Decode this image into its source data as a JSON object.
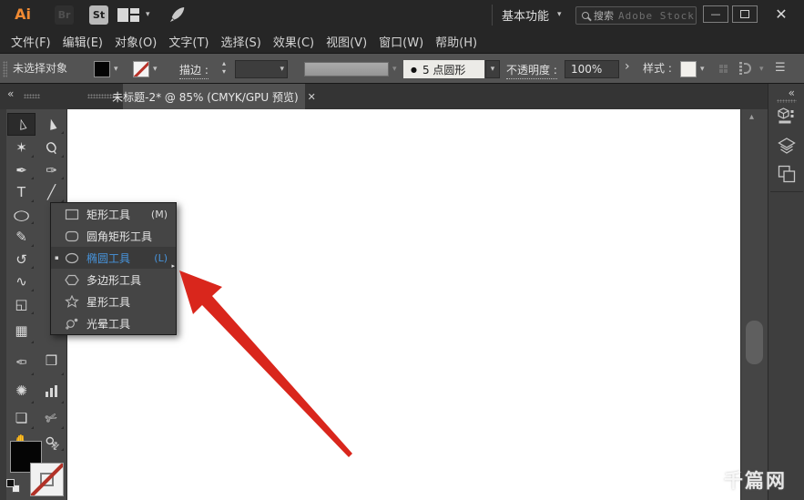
{
  "titlebar": {
    "app_logo": "Ai",
    "bridge_label": "Br",
    "stock_label": "St",
    "workspace_switcher": "基本功能",
    "search_text": "搜索",
    "search_placeholder": "Adobe Stock"
  },
  "menubar": {
    "items": [
      "文件(F)",
      "编辑(E)",
      "对象(O)",
      "文字(T)",
      "选择(S)",
      "效果(C)",
      "视图(V)",
      "窗口(W)",
      "帮助(H)"
    ]
  },
  "controlbar": {
    "no_selection": "未选择对象",
    "stroke_label": "描边 :",
    "brush_dot": "●",
    "brush_value": "5 点圆形",
    "opacity_label": "不透明度 :",
    "opacity_value": "100%",
    "style_label": "样式 :"
  },
  "tabbar": {
    "document_title": "未标题-2* @ 85% (CMYK/GPU 预览)"
  },
  "toolbar": {
    "columns": [
      [
        {
          "name": "selection-tool",
          "glyph": "▻",
          "rotate": -105,
          "active": true
        },
        {
          "name": "magic-wand-tool",
          "glyph": "✶"
        },
        {
          "name": "pen-tool",
          "glyph": "✒"
        },
        {
          "name": "type-tool",
          "glyph": "T"
        },
        {
          "name": "ellipse-tool",
          "glyph": "○",
          "wide": true
        },
        {
          "name": "shaper-tool",
          "glyph": "✎"
        },
        {
          "name": "rotate-tool",
          "glyph": "↺"
        },
        {
          "name": "width-tool",
          "glyph": "∿"
        },
        {
          "name": "free-transform-tool",
          "glyph": "◱"
        },
        {
          "name": "mesh-tool",
          "glyph": "▦"
        },
        {
          "name": "eyedropper-tool",
          "glyph": "✑",
          "rotate": 180
        },
        {
          "name": "symbol-sprayer-tool",
          "glyph": "✺"
        },
        {
          "name": "artboard-tool",
          "glyph": "❏"
        },
        {
          "name": "hand-tool",
          "glyph": "✋"
        }
      ],
      [
        {
          "name": "direct-selection-tool",
          "glyph": "►",
          "rotate": -105
        },
        {
          "name": "lasso-tool",
          "glyph": "Ϙ",
          "rotate": -35
        },
        {
          "name": "curvature-tool",
          "glyph": "✑"
        },
        {
          "name": "line-segment-tool",
          "glyph": "╱"
        },
        {
          "name": "hidden-tool-slot",
          "empty": true
        },
        {
          "name": "hidden-tool-slot",
          "empty": true
        },
        {
          "name": "hidden-tool-slot",
          "empty": true
        },
        {
          "name": "hidden-tool-slot",
          "empty": true
        },
        {
          "name": "hidden-tool-slot",
          "empty": true
        },
        {
          "name": "hidden-tool-slot",
          "empty": true
        },
        {
          "name": "shape-builder-tool",
          "glyph": "❒"
        },
        {
          "name": "graph-tool",
          "bars": true
        },
        {
          "name": "knife-tool",
          "glyph": "✄",
          "rotate": -20
        },
        {
          "name": "zoom-tool",
          "glyph": "⚲",
          "rotate": -45
        }
      ]
    ]
  },
  "flyout": {
    "items": [
      {
        "label": "矩形工具",
        "shortcut": "(M)"
      },
      {
        "label": "圆角矩形工具",
        "shortcut": ""
      },
      {
        "label": "椭圆工具",
        "shortcut": "(L)"
      },
      {
        "label": "多边形工具",
        "shortcut": ""
      },
      {
        "label": "星形工具",
        "shortcut": ""
      },
      {
        "label": "光晕工具",
        "shortcut": ""
      }
    ]
  },
  "icons": {
    "chevron_down": "▾",
    "collapse": "«",
    "menu": "☰",
    "close": "✕",
    "minimize": "—",
    "more": "›",
    "bullet": "▪",
    "flyout_arrow": "▸",
    "scroll_up": "▴",
    "stepper_up": "▴",
    "stepper_down": "▾",
    "swap": "⇄"
  },
  "watermark": "千篇网",
  "colors": {
    "accent_blue": "#4794dc",
    "arrow_red": "#d9261c",
    "logo_orange": "#f08a33"
  }
}
